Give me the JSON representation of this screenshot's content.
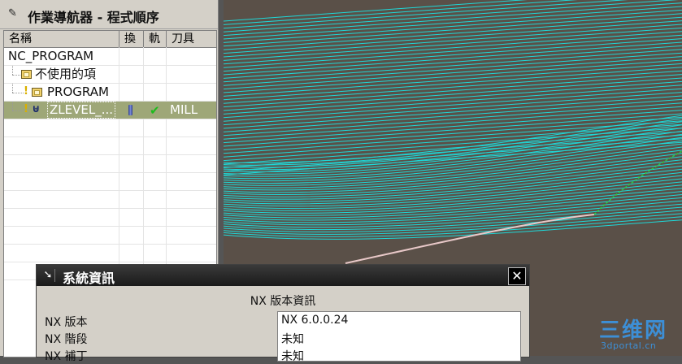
{
  "navigator": {
    "title": "作業導航器 - 程式順序",
    "columns": [
      "名稱",
      "換",
      "軌",
      "刀具"
    ],
    "rows": [
      {
        "name": "NC_PROGRAM",
        "change": "",
        "path": "",
        "tool": ""
      },
      {
        "name": "不使用的項",
        "change": "",
        "path": "",
        "tool": ""
      },
      {
        "name": "PROGRAM",
        "change": "",
        "path": "",
        "tool": ""
      },
      {
        "name": "ZLEVEL_...",
        "change": "tool-icon",
        "path": "check-icon",
        "tool": "MILL",
        "selected": true
      }
    ]
  },
  "dialog": {
    "title": "系統資訊",
    "close_glyph": "✕",
    "heading": "NX 版本資訊",
    "labels": [
      "NX 版本",
      "NX 階段",
      "NX 補丁"
    ],
    "values": [
      "NX 6.0.0.24",
      "未知",
      "未知"
    ]
  },
  "watermark": {
    "main": "三维网",
    "sub": "3dportal.cn"
  },
  "colors": {
    "toolpath": "#1ed8d8",
    "part_surface": "#5a5048",
    "selection": "#9ea778",
    "engage_path": "#2ecc40"
  }
}
